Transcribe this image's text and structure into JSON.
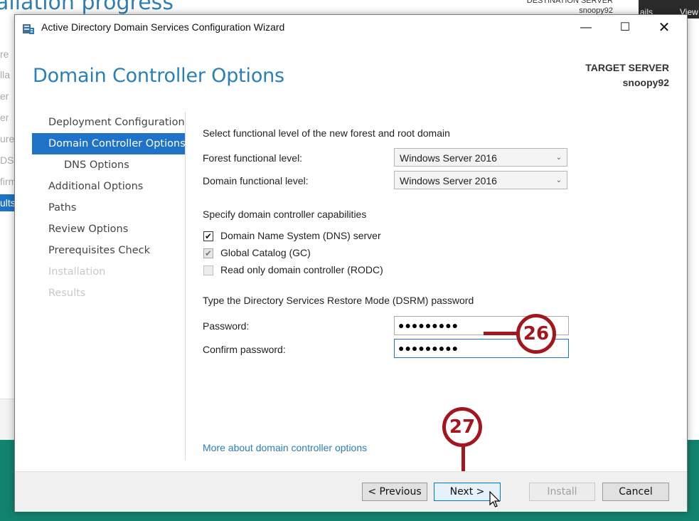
{
  "background": {
    "title": "allation progress",
    "dest_label": "DESTINATION SERVER",
    "dest_name": "snoopy92",
    "dark_tab_1": "ails",
    "dark_tab_2": "View",
    "sidebar_fragments": [
      "re",
      "lla",
      "er",
      "er",
      "ure",
      "DS",
      "firm"
    ],
    "results_fragment": "ults"
  },
  "window": {
    "title": "Active Directory Domain Services Configuration Wizard",
    "min_glyph": "—",
    "max_glyph": "☐",
    "close_glyph": "✕"
  },
  "header": {
    "page_title": "Domain Controller Options",
    "target_label": "TARGET SERVER",
    "target_name": "snoopy92"
  },
  "nav": {
    "items": [
      {
        "label": "Deployment Configuration"
      },
      {
        "label": "Domain Controller Options"
      },
      {
        "label": "DNS Options"
      },
      {
        "label": "Additional Options"
      },
      {
        "label": "Paths"
      },
      {
        "label": "Review Options"
      },
      {
        "label": "Prerequisites Check"
      },
      {
        "label": "Installation"
      },
      {
        "label": "Results"
      }
    ]
  },
  "form": {
    "functional_heading": "Select functional level of the new forest and root domain",
    "forest_label": "Forest functional level:",
    "forest_value": "Windows Server 2016",
    "domain_label": "Domain functional level:",
    "domain_value": "Windows Server 2016",
    "capabilities_heading": "Specify domain controller capabilities",
    "dns_label": "Domain Name System (DNS) server",
    "gc_label": "Global Catalog (GC)",
    "rodc_label": "Read only domain controller (RODC)",
    "checkmark": "✔",
    "dsrm_heading": "Type the Directory Services Restore Mode (DSRM) password",
    "password_label": "Password:",
    "password_value": "●●●●●●●●●",
    "confirm_label": "Confirm password:",
    "confirm_value": "●●●●●●●●●",
    "more_link": "More about domain controller options",
    "chevron": "⌄"
  },
  "footer": {
    "previous": "< Previous",
    "next": "Next >",
    "install": "Install",
    "cancel": "Cancel"
  },
  "callouts": {
    "first": "26",
    "second": "27",
    "color": "#a3161e"
  },
  "colors": {
    "accent": "#1e73c8",
    "title_blue": "#2b7fb8",
    "background_green": "#12836f"
  }
}
